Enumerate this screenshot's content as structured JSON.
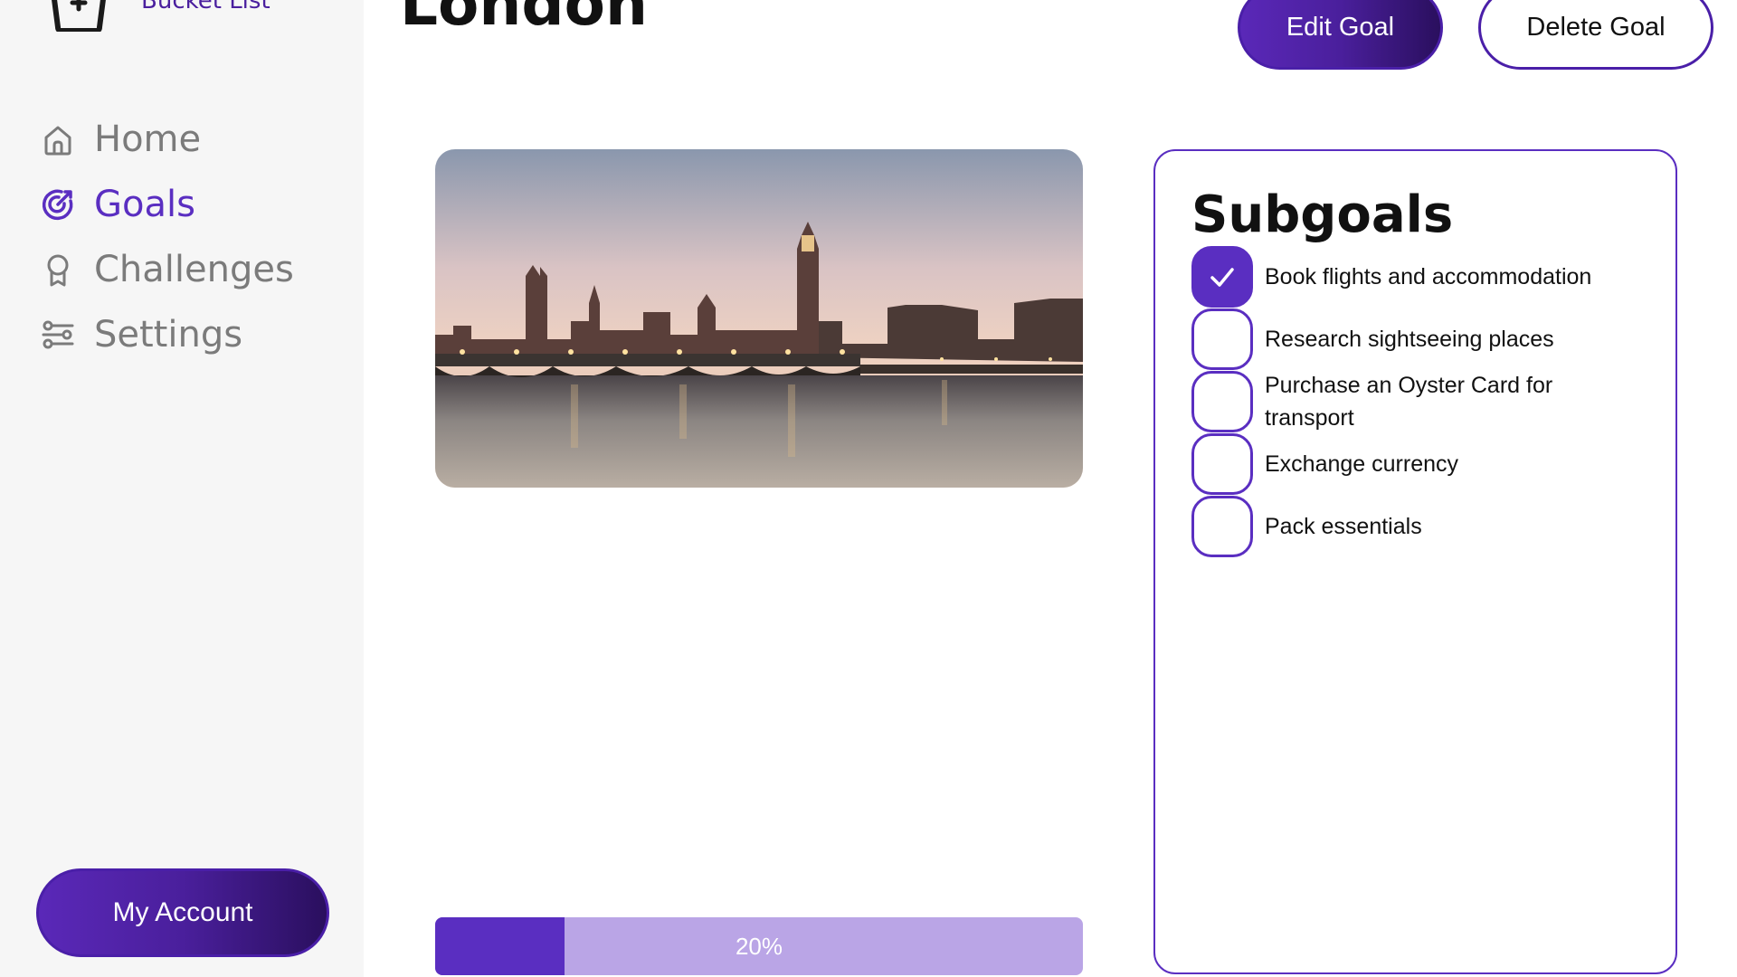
{
  "app": {
    "name": "Bucket List"
  },
  "sidebar": {
    "items": [
      {
        "label": "Home",
        "icon": "home-icon",
        "active": false
      },
      {
        "label": "Goals",
        "icon": "goals-icon",
        "active": true
      },
      {
        "label": "Challenges",
        "icon": "award-icon",
        "active": false
      },
      {
        "label": "Settings",
        "icon": "sliders-icon",
        "active": false
      }
    ],
    "account_label": "My Account"
  },
  "header": {
    "title": "London",
    "edit_label": "Edit Goal",
    "delete_label": "Delete Goal"
  },
  "goal": {
    "image_subject": "London skyline with Westminster Bridge and Big Ben at sunset",
    "progress_value": 0.2,
    "progress_label": "20%"
  },
  "subgoals": {
    "title": "Subgoals",
    "items": [
      {
        "label": "Book flights and accommodation",
        "done": true
      },
      {
        "label": "Research sightseeing places",
        "done": false
      },
      {
        "label": "Purchase an Oyster Card for transport",
        "done": false
      },
      {
        "label": "Exchange currency",
        "done": false
      },
      {
        "label": "Pack essentials",
        "done": false
      }
    ]
  },
  "colors": {
    "accent": "#5a2ec1",
    "accent_dark": "#2a0f5e",
    "progress_track": "#baa5e6",
    "nav_inactive": "#7b7b7b",
    "sidebar_bg": "#f6f6f6"
  }
}
